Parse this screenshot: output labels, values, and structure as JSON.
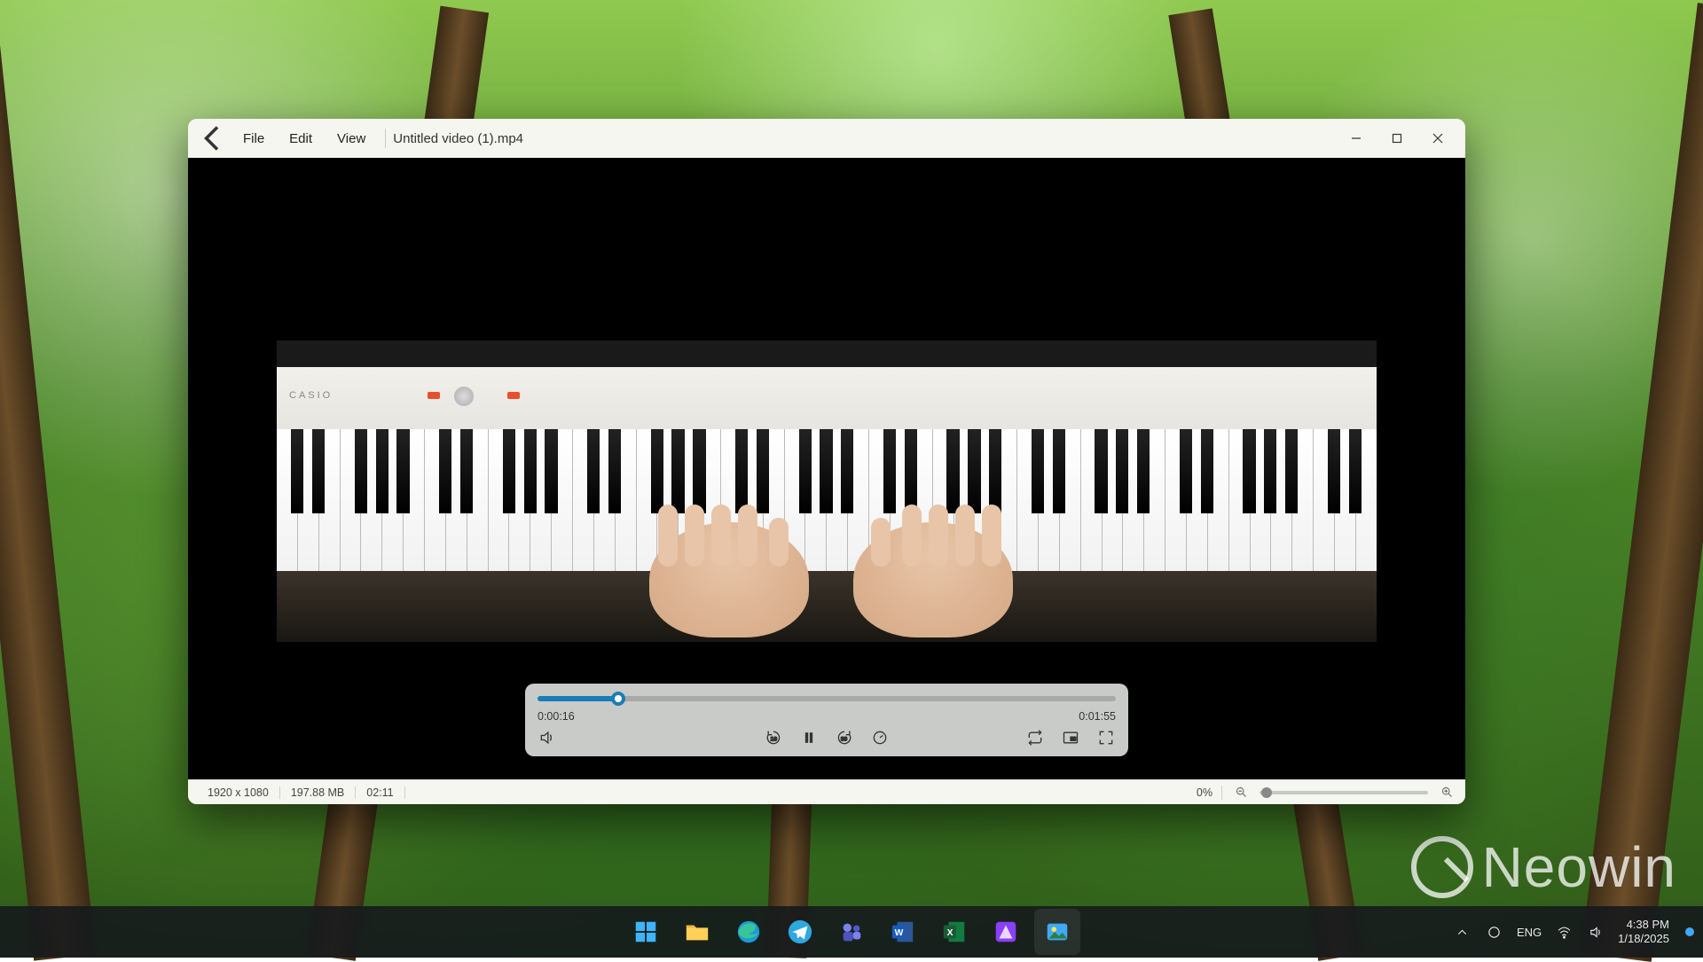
{
  "app": {
    "menu": {
      "file": "File",
      "edit": "Edit",
      "view": "View"
    },
    "filename": "Untitled video (1).mp4"
  },
  "playback": {
    "elapsed": "0:00:16",
    "total": "0:01:55",
    "progress_percent": 14,
    "skip_back_label": "10",
    "skip_fwd_label": "30"
  },
  "statusbar": {
    "resolution": "1920 x 1080",
    "filesize": "197.88 MB",
    "duration": "02:11",
    "zoom_value": "0%"
  },
  "systray": {
    "lang": "ENG",
    "time": "4:38 PM",
    "date": "1/18/2025"
  },
  "watermark": "Neowin",
  "piano_brand": "CASIO"
}
